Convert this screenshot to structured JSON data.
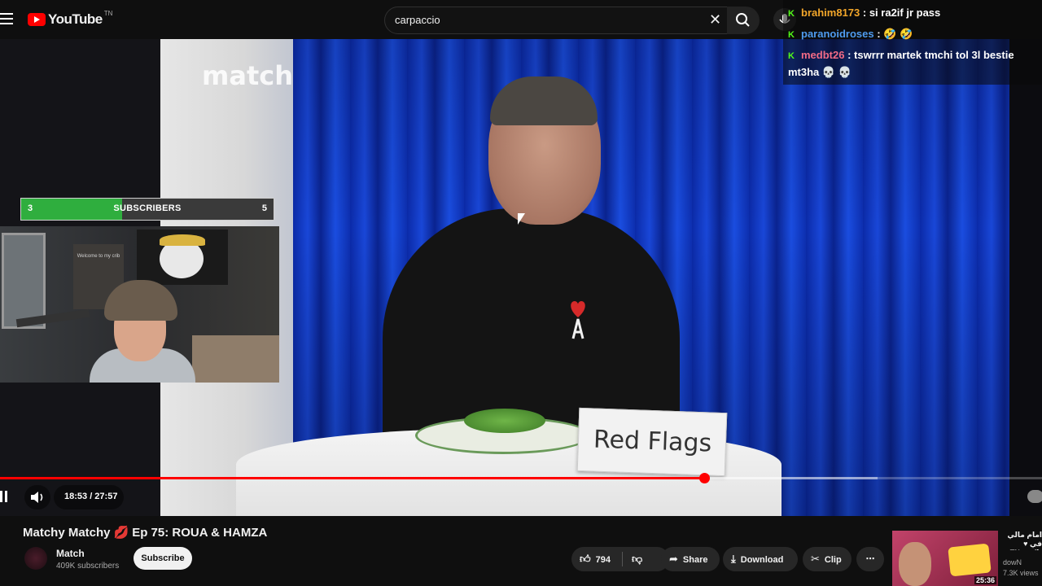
{
  "header": {
    "logo_text": "YouTube",
    "logo_region": "TN",
    "search_value": "carpaccio"
  },
  "video": {
    "watermark": "match",
    "card_text": "Red Flags"
  },
  "sub_goal": {
    "start": "3",
    "label": "SUBSCRIBERS",
    "end": "5",
    "progress_fraction": 0.4,
    "fill_color": "#2fae3e"
  },
  "webcam": {
    "poster_text": "Welcome to my crib"
  },
  "chat": {
    "messages": [
      {
        "user": "brahim8173",
        "text": ": si ra2if jr pass",
        "color": "#f2a62a"
      },
      {
        "user": "paranoidroses",
        "text": ": 🤣 🤣",
        "color": "#4f9cf0"
      },
      {
        "user": "medbt26",
        "text": ": tswrrr martek tmchi tol 3l bestie mt3ha 💀 💀",
        "color": "#f26b86"
      }
    ]
  },
  "player": {
    "time": "18:53 / 27:57",
    "played_fraction": 0.6757,
    "buffered_fraction": 0.842
  },
  "meta": {
    "title_pre": "Matchy Matchy",
    "title_post": "Ep 75: ROUA & HAMZA",
    "channel_name": "Match",
    "subscribers": "409K subscribers",
    "subscribe_label": "Subscribe",
    "likes": "794",
    "share_label": "Share",
    "download_label": "Download",
    "clip_label": "Clip"
  },
  "sidebar_video": {
    "title": "امام مالي في ♥ تاكس TN",
    "channel": "dowN",
    "views": "7.3K views",
    "duration": "25:36"
  },
  "colors": {
    "accent": "#ff0000",
    "background": "#0f0f0f"
  }
}
